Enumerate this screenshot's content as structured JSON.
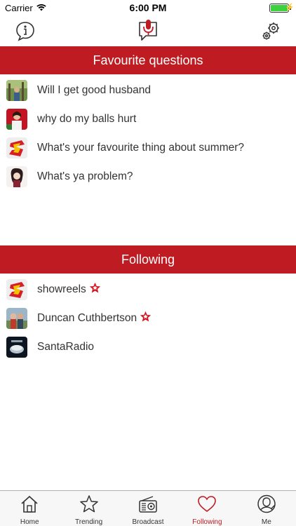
{
  "status": {
    "carrier": "Carrier",
    "time": "6:00 PM"
  },
  "nav": {
    "left_icon": "info-bubble-icon",
    "center_icon": "mic-bubble-icon",
    "right_icon": "gears-icon"
  },
  "favourites": {
    "header": "Favourite questions",
    "items": [
      {
        "label": "Will I get good husband",
        "avatar": "forest-photo"
      },
      {
        "label": "why do my balls hurt",
        "avatar": "red-portrait"
      },
      {
        "label": "What's your favourite thing about summer?",
        "avatar": "s-logo"
      },
      {
        "label": "What's ya problem?",
        "avatar": "anime-portrait"
      }
    ]
  },
  "following": {
    "header": "Following",
    "items": [
      {
        "label": "showreels",
        "avatar": "s-logo",
        "starred": true
      },
      {
        "label": "Duncan Cuthbertson",
        "avatar": "couple-photo",
        "starred": true
      },
      {
        "label": "SantaRadio",
        "avatar": "radio-logo",
        "starred": false
      }
    ]
  },
  "tabs": [
    {
      "label": "Home",
      "icon": "home-icon",
      "active": false
    },
    {
      "label": "Trending",
      "icon": "star-icon",
      "active": false
    },
    {
      "label": "Broadcast",
      "icon": "radio-icon",
      "active": false
    },
    {
      "label": "Following",
      "icon": "heart-icon",
      "active": true
    },
    {
      "label": "Me",
      "icon": "profile-icon",
      "active": false
    }
  ],
  "colors": {
    "accent": "#be1c22",
    "star": "#d8121f"
  }
}
